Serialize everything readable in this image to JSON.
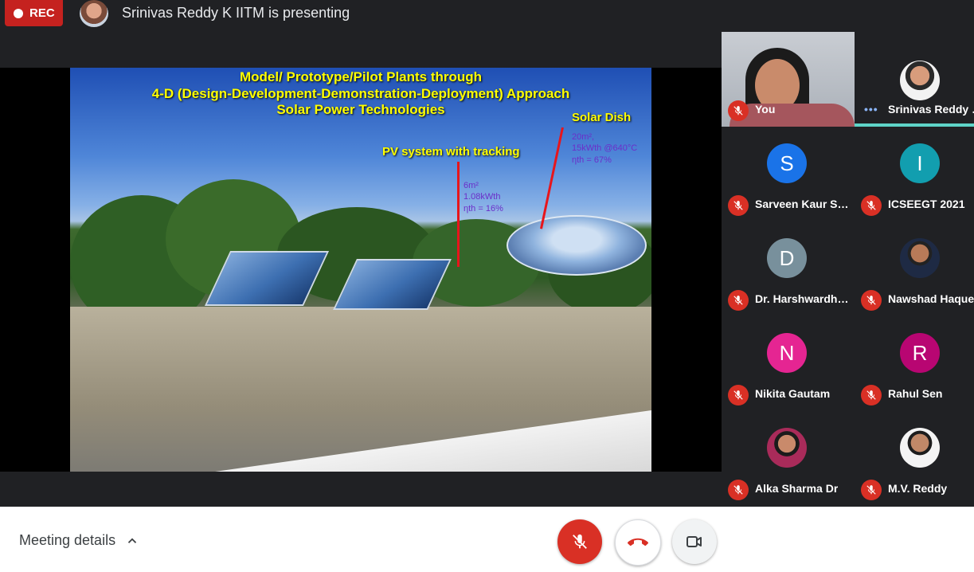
{
  "topbar": {
    "rec_label": "REC",
    "presenter_title": "Srinivas Reddy K IITM is presenting"
  },
  "slide": {
    "title_line1": "Model/ Prototype/Pilot Plants through",
    "title_line2": "4-D (Design-Development-Demonstration-Deployment) Approach",
    "title_line3": "Solar Power Technologies",
    "pv_label": "PV system with tracking",
    "pv_spec1": "6m²",
    "pv_spec2": "1.08kWth",
    "pv_spec3": "ηth = 16%",
    "dish_label": "Solar Dish",
    "dish_spec1": "20m²,",
    "dish_spec2": "15kWth @640°C",
    "dish_spec3": "ηth = 67%"
  },
  "participants": [
    {
      "name": "You",
      "muted": true,
      "type": "video"
    },
    {
      "name": "Srinivas Reddy K...",
      "muted": false,
      "type": "photo",
      "active": true
    },
    {
      "name": "Sarveen Kaur Sa...",
      "initial": "S",
      "color": "#1a73e8",
      "muted": true
    },
    {
      "name": "ICSEEGT 2021",
      "initial": "I",
      "color": "#129eaf",
      "muted": true
    },
    {
      "name": "Dr. Harshwardha...",
      "initial": "D",
      "color": "#78909c",
      "muted": true
    },
    {
      "name": "Nawshad Haque",
      "type": "photo",
      "muted": true
    },
    {
      "name": "Nikita Gautam",
      "initial": "N",
      "color": "#e52592",
      "muted": true
    },
    {
      "name": "Rahul Sen",
      "initial": "R",
      "color": "#b80672",
      "muted": true
    },
    {
      "name": "Alka Sharma Dr",
      "type": "photo",
      "muted": true
    },
    {
      "name": "M.V. Reddy",
      "type": "photo",
      "muted": true
    }
  ],
  "controls": {
    "meeting_details_label": "Meeting details",
    "mic_state": "muted",
    "hangup_icon": "phone-hangup-icon",
    "camera_icon": "camera-icon"
  },
  "colors": {
    "rec": "#c5221f",
    "mute": "#d93025",
    "active_speaker": "#5ed4c8",
    "background": "#202124"
  }
}
